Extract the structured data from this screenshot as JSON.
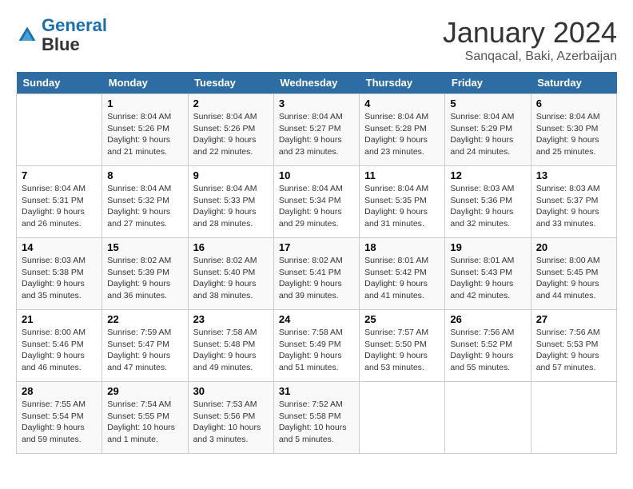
{
  "header": {
    "logo_line1": "General",
    "logo_line2": "Blue",
    "month": "January 2024",
    "location": "Sanqacal, Baki, Azerbaijan"
  },
  "weekdays": [
    "Sunday",
    "Monday",
    "Tuesday",
    "Wednesday",
    "Thursday",
    "Friday",
    "Saturday"
  ],
  "weeks": [
    [
      {
        "num": "",
        "info": ""
      },
      {
        "num": "1",
        "info": "Sunrise: 8:04 AM\nSunset: 5:26 PM\nDaylight: 9 hours\nand 21 minutes."
      },
      {
        "num": "2",
        "info": "Sunrise: 8:04 AM\nSunset: 5:26 PM\nDaylight: 9 hours\nand 22 minutes."
      },
      {
        "num": "3",
        "info": "Sunrise: 8:04 AM\nSunset: 5:27 PM\nDaylight: 9 hours\nand 23 minutes."
      },
      {
        "num": "4",
        "info": "Sunrise: 8:04 AM\nSunset: 5:28 PM\nDaylight: 9 hours\nand 23 minutes."
      },
      {
        "num": "5",
        "info": "Sunrise: 8:04 AM\nSunset: 5:29 PM\nDaylight: 9 hours\nand 24 minutes."
      },
      {
        "num": "6",
        "info": "Sunrise: 8:04 AM\nSunset: 5:30 PM\nDaylight: 9 hours\nand 25 minutes."
      }
    ],
    [
      {
        "num": "7",
        "info": "Sunrise: 8:04 AM\nSunset: 5:31 PM\nDaylight: 9 hours\nand 26 minutes."
      },
      {
        "num": "8",
        "info": "Sunrise: 8:04 AM\nSunset: 5:32 PM\nDaylight: 9 hours\nand 27 minutes."
      },
      {
        "num": "9",
        "info": "Sunrise: 8:04 AM\nSunset: 5:33 PM\nDaylight: 9 hours\nand 28 minutes."
      },
      {
        "num": "10",
        "info": "Sunrise: 8:04 AM\nSunset: 5:34 PM\nDaylight: 9 hours\nand 29 minutes."
      },
      {
        "num": "11",
        "info": "Sunrise: 8:04 AM\nSunset: 5:35 PM\nDaylight: 9 hours\nand 31 minutes."
      },
      {
        "num": "12",
        "info": "Sunrise: 8:03 AM\nSunset: 5:36 PM\nDaylight: 9 hours\nand 32 minutes."
      },
      {
        "num": "13",
        "info": "Sunrise: 8:03 AM\nSunset: 5:37 PM\nDaylight: 9 hours\nand 33 minutes."
      }
    ],
    [
      {
        "num": "14",
        "info": "Sunrise: 8:03 AM\nSunset: 5:38 PM\nDaylight: 9 hours\nand 35 minutes."
      },
      {
        "num": "15",
        "info": "Sunrise: 8:02 AM\nSunset: 5:39 PM\nDaylight: 9 hours\nand 36 minutes."
      },
      {
        "num": "16",
        "info": "Sunrise: 8:02 AM\nSunset: 5:40 PM\nDaylight: 9 hours\nand 38 minutes."
      },
      {
        "num": "17",
        "info": "Sunrise: 8:02 AM\nSunset: 5:41 PM\nDaylight: 9 hours\nand 39 minutes."
      },
      {
        "num": "18",
        "info": "Sunrise: 8:01 AM\nSunset: 5:42 PM\nDaylight: 9 hours\nand 41 minutes."
      },
      {
        "num": "19",
        "info": "Sunrise: 8:01 AM\nSunset: 5:43 PM\nDaylight: 9 hours\nand 42 minutes."
      },
      {
        "num": "20",
        "info": "Sunrise: 8:00 AM\nSunset: 5:45 PM\nDaylight: 9 hours\nand 44 minutes."
      }
    ],
    [
      {
        "num": "21",
        "info": "Sunrise: 8:00 AM\nSunset: 5:46 PM\nDaylight: 9 hours\nand 46 minutes."
      },
      {
        "num": "22",
        "info": "Sunrise: 7:59 AM\nSunset: 5:47 PM\nDaylight: 9 hours\nand 47 minutes."
      },
      {
        "num": "23",
        "info": "Sunrise: 7:58 AM\nSunset: 5:48 PM\nDaylight: 9 hours\nand 49 minutes."
      },
      {
        "num": "24",
        "info": "Sunrise: 7:58 AM\nSunset: 5:49 PM\nDaylight: 9 hours\nand 51 minutes."
      },
      {
        "num": "25",
        "info": "Sunrise: 7:57 AM\nSunset: 5:50 PM\nDaylight: 9 hours\nand 53 minutes."
      },
      {
        "num": "26",
        "info": "Sunrise: 7:56 AM\nSunset: 5:52 PM\nDaylight: 9 hours\nand 55 minutes."
      },
      {
        "num": "27",
        "info": "Sunrise: 7:56 AM\nSunset: 5:53 PM\nDaylight: 9 hours\nand 57 minutes."
      }
    ],
    [
      {
        "num": "28",
        "info": "Sunrise: 7:55 AM\nSunset: 5:54 PM\nDaylight: 9 hours\nand 59 minutes."
      },
      {
        "num": "29",
        "info": "Sunrise: 7:54 AM\nSunset: 5:55 PM\nDaylight: 10 hours\nand 1 minute."
      },
      {
        "num": "30",
        "info": "Sunrise: 7:53 AM\nSunset: 5:56 PM\nDaylight: 10 hours\nand 3 minutes."
      },
      {
        "num": "31",
        "info": "Sunrise: 7:52 AM\nSunset: 5:58 PM\nDaylight: 10 hours\nand 5 minutes."
      },
      {
        "num": "",
        "info": ""
      },
      {
        "num": "",
        "info": ""
      },
      {
        "num": "",
        "info": ""
      }
    ]
  ]
}
